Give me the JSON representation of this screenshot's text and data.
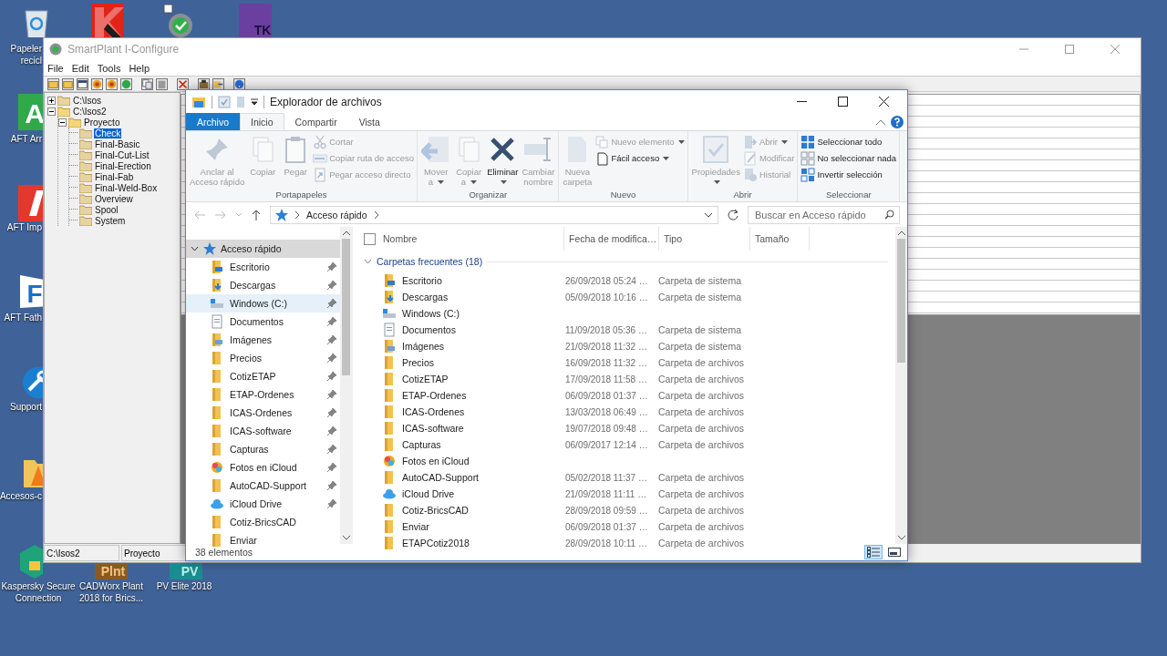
{
  "desktop_icons": [
    {
      "kind": "recycle",
      "lines": [
        "Papeler",
        "recicl"
      ]
    },
    {
      "kind": "kaspersky"
    },
    {
      "kind": "gear-check"
    },
    {
      "kind": "tk",
      "badge": "TK"
    },
    {
      "kind": "aft-a",
      "badge": "A",
      "lines": [
        "AFT Arr"
      ]
    },
    {
      "kind": "aft-i",
      "lines": [
        "AFT Imp"
      ]
    },
    {
      "kind": "aft-f",
      "badge": "F",
      "lines": [
        "AFT Fath"
      ]
    },
    {
      "kind": "support",
      "lines": [
        "Support"
      ]
    },
    {
      "kind": "folder-cone",
      "lines": [
        "Accesos-c"
      ]
    },
    {
      "kind": "vpn",
      "lines": [
        "Kaspersky Secure",
        "Connection"
      ]
    },
    {
      "kind": "cadworx",
      "badge": "Plnt",
      "lines": [
        "CADWorx Plant",
        "2018 for Brics..."
      ]
    },
    {
      "kind": "pvelite",
      "badge": "PV",
      "lines": [
        "PV Elite 2018"
      ]
    }
  ],
  "smartplant": {
    "title": "SmartPlant I-Configure",
    "menu": [
      "File",
      "Edit",
      "Tools",
      "Help"
    ],
    "tree": [
      {
        "label": "C:\\Isos",
        "expanded": false,
        "selected": false
      },
      {
        "label": "C:\\Isos2",
        "expanded": true,
        "selected": false,
        "children": [
          {
            "label": "Proyecto",
            "expanded": true,
            "selected": false,
            "children": [
              {
                "label": "Check",
                "selected": true
              },
              {
                "label": "Final-Basic",
                "selected": false
              },
              {
                "label": "Final-Cut-List",
                "selected": false
              },
              {
                "label": "Final-Erection",
                "selected": false
              },
              {
                "label": "Final-Fab",
                "selected": false
              },
              {
                "label": "Final-Weld-Box",
                "selected": false
              },
              {
                "label": "Overview",
                "selected": false
              },
              {
                "label": "Spool",
                "selected": false
              },
              {
                "label": "System",
                "selected": false
              }
            ]
          }
        ]
      }
    ],
    "status_bar": [
      "C:\\Isos2",
      "Proyecto"
    ]
  },
  "explorer": {
    "title": "Explorador de archivos",
    "tabs": [
      {
        "label": "Archivo",
        "kind": "file",
        "selected": false
      },
      {
        "label": "Inicio",
        "kind": "tab",
        "selected": true
      },
      {
        "label": "Compartir",
        "kind": "tab",
        "selected": false
      },
      {
        "label": "Vista",
        "kind": "tab",
        "selected": false
      }
    ],
    "groups": [
      {
        "label": "Portapapeles",
        "items": [
          {
            "kind": "large",
            "lines": [
              "Anclar al",
              "Acceso rápido"
            ],
            "disabled": true
          },
          {
            "kind": "large",
            "lines": [
              "Copiar"
            ],
            "disabled": true
          },
          {
            "kind": "large",
            "lines": [
              "Pegar"
            ],
            "disabled": true
          },
          {
            "kind": "small",
            "lines": [
              "Cortar"
            ],
            "disabled": true
          },
          {
            "kind": "small",
            "lines": [
              "Copiar ruta de acceso"
            ],
            "disabled": true
          },
          {
            "kind": "small",
            "lines": [
              "Pegar acceso directo"
            ],
            "disabled": true
          }
        ]
      },
      {
        "label": "Organizar",
        "items": [
          {
            "kind": "large",
            "lines": [
              "Mover",
              "a"
            ],
            "disabled": true,
            "has_menu": true
          },
          {
            "kind": "large",
            "lines": [
              "Copiar",
              "a"
            ],
            "disabled": true,
            "has_menu": true
          },
          {
            "kind": "large",
            "lines": [
              "Eliminar"
            ],
            "disabled": false,
            "has_menu": true
          },
          {
            "kind": "large",
            "lines": [
              "Cambiar",
              "nombre"
            ],
            "disabled": true
          }
        ]
      },
      {
        "label": "Nuevo",
        "items": [
          {
            "kind": "large",
            "lines": [
              "Nueva",
              "carpeta"
            ],
            "disabled": true
          },
          {
            "kind": "small",
            "lines": [
              "Nuevo elemento"
            ],
            "disabled": true,
            "has_menu": true
          },
          {
            "kind": "small",
            "lines": [
              "Fácil acceso"
            ],
            "disabled": false,
            "has_menu": true
          }
        ]
      },
      {
        "label": "Abrir",
        "items": [
          {
            "kind": "large",
            "lines": [
              "Propiedades"
            ],
            "disabled": true,
            "has_menu": true
          },
          {
            "kind": "small",
            "lines": [
              "Abrir"
            ],
            "disabled": true,
            "has_menu": true
          },
          {
            "kind": "small",
            "lines": [
              "Modificar"
            ],
            "disabled": true
          },
          {
            "kind": "small",
            "lines": [
              "Historial"
            ],
            "disabled": true
          }
        ]
      },
      {
        "label": "Seleccionar",
        "items": [
          {
            "kind": "small",
            "lines": [
              "Seleccionar todo"
            ],
            "disabled": false
          },
          {
            "kind": "small",
            "lines": [
              "No seleccionar nada"
            ],
            "disabled": false
          },
          {
            "kind": "small",
            "lines": [
              "Invertir selección"
            ],
            "disabled": false
          }
        ]
      }
    ],
    "address": {
      "crumbs": [
        "Acceso rápido"
      ]
    },
    "search": {
      "placeholder": "Buscar en Acceso rápido"
    },
    "nav_pane": {
      "header": {
        "label": "Acceso rápido",
        "expanded": true,
        "selected": true
      },
      "items": [
        {
          "label": "Escritorio",
          "kind": "desktop",
          "pinned": true,
          "hover": false
        },
        {
          "label": "Descargas",
          "kind": "downloads",
          "pinned": true,
          "hover": false
        },
        {
          "label": "Windows (C:)",
          "kind": "drive",
          "pinned": true,
          "hover": true
        },
        {
          "label": "Documentos",
          "kind": "documents",
          "pinned": true,
          "hover": false
        },
        {
          "label": "Imágenes",
          "kind": "pictures",
          "pinned": true,
          "hover": false
        },
        {
          "label": "Precios",
          "kind": "folder",
          "pinned": true,
          "hover": false
        },
        {
          "label": "CotizETAP",
          "kind": "folder",
          "pinned": true,
          "hover": false
        },
        {
          "label": "ETAP-Ordenes",
          "kind": "folder",
          "pinned": true,
          "hover": false
        },
        {
          "label": "ICAS-Ordenes",
          "kind": "folder",
          "pinned": true,
          "hover": false
        },
        {
          "label": "ICAS-software",
          "kind": "folder",
          "pinned": true,
          "hover": false
        },
        {
          "label": "Capturas",
          "kind": "folder",
          "pinned": true,
          "hover": false
        },
        {
          "label": "Fotos en iCloud",
          "kind": "photos",
          "pinned": true,
          "hover": false
        },
        {
          "label": "AutoCAD-Support",
          "kind": "folder",
          "pinned": true,
          "hover": false
        },
        {
          "label": "iCloud Drive",
          "kind": "cloud",
          "pinned": true,
          "hover": false
        },
        {
          "label": "Cotiz-BricsCAD",
          "kind": "folder",
          "pinned": false,
          "hover": false
        },
        {
          "label": "Enviar",
          "kind": "folder",
          "pinned": false,
          "hover": false
        }
      ]
    },
    "select_all": {
      "checked": false
    },
    "columns": [
      "Nombre",
      "Fecha de modifica…",
      "Tipo",
      "Tamaño"
    ],
    "group": {
      "label": "Carpetas frecuentes (18)",
      "expanded": true
    },
    "rows": [
      {
        "name": "Escritorio",
        "kind": "desktop",
        "date": "26/09/2018 05:24 …",
        "type": "Carpeta de sistema"
      },
      {
        "name": "Descargas",
        "kind": "downloads",
        "date": "05/09/2018 10:16 …",
        "type": "Carpeta de sistema"
      },
      {
        "name": "Windows (C:)",
        "kind": "drive"
      },
      {
        "name": "Documentos",
        "kind": "documents",
        "date": "11/09/2018 05:36 …",
        "type": "Carpeta de sistema"
      },
      {
        "name": "Imágenes",
        "kind": "pictures",
        "date": "21/09/2018 11:32 …",
        "type": "Carpeta de sistema"
      },
      {
        "name": "Precios",
        "kind": "folder",
        "date": "16/09/2018 11:32 …",
        "type": "Carpeta de archivos"
      },
      {
        "name": "CotizETAP",
        "kind": "folder",
        "date": "17/09/2018 11:58 …",
        "type": "Carpeta de archivos"
      },
      {
        "name": "ETAP-Ordenes",
        "kind": "folder",
        "date": "06/09/2018 01:37 …",
        "type": "Carpeta de archivos"
      },
      {
        "name": "ICAS-Ordenes",
        "kind": "folder",
        "date": "13/03/2018 06:49 …",
        "type": "Carpeta de archivos"
      },
      {
        "name": "ICAS-software",
        "kind": "folder",
        "date": "19/07/2018 09:48 …",
        "type": "Carpeta de archivos"
      },
      {
        "name": "Capturas",
        "kind": "folder",
        "date": "06/09/2017 12:14 …",
        "type": "Carpeta de archivos"
      },
      {
        "name": "Fotos en iCloud",
        "kind": "photos"
      },
      {
        "name": "AutoCAD-Support",
        "kind": "folder",
        "date": "05/02/2018 11:37 …",
        "type": "Carpeta de archivos"
      },
      {
        "name": "iCloud Drive",
        "kind": "cloud",
        "date": "21/09/2018 11:11 …",
        "type": "Carpeta de archivos"
      },
      {
        "name": "Cotiz-BricsCAD",
        "kind": "folder",
        "date": "28/09/2018 09:59 …",
        "type": "Carpeta de archivos"
      },
      {
        "name": "Enviar",
        "kind": "folder",
        "date": "06/09/2018 01:37 …",
        "type": "Carpeta de archivos"
      },
      {
        "name": "ETAPCotiz2018",
        "kind": "folder",
        "date": "28/09/2018 10:11 …",
        "type": "Carpeta de archivos"
      }
    ],
    "status": "38 elementos",
    "views": [
      {
        "kind": "details",
        "selected": true
      },
      {
        "kind": "large-icons",
        "selected": false
      }
    ]
  }
}
